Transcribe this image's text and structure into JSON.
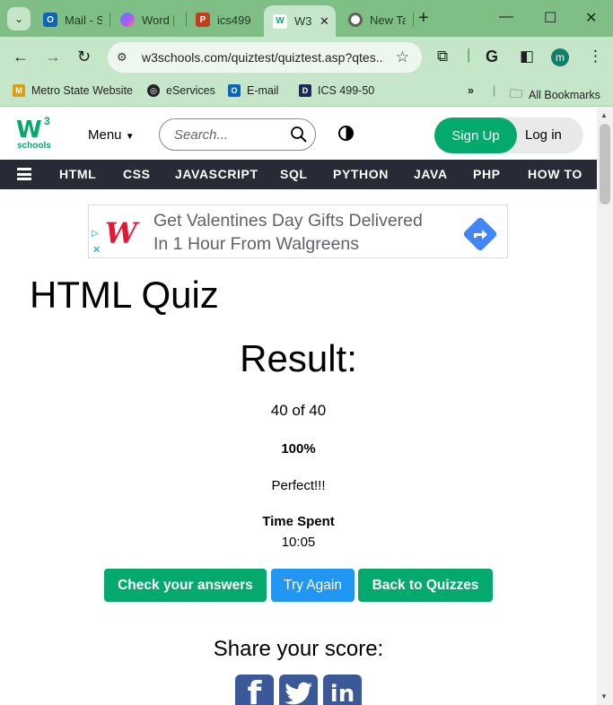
{
  "browser": {
    "tabs": [
      {
        "label": "Mail - S",
        "icon": "outlook-icon",
        "color": "#0a64b8"
      },
      {
        "label": "Word |",
        "icon": "copilot-icon",
        "color": "#7b5cd6"
      },
      {
        "label": "ics499.",
        "icon": "powerpoint-icon",
        "color": "#c43e1c"
      },
      {
        "label": "W3",
        "icon": "w3schools-icon",
        "color": "#04aa6d",
        "active": true
      },
      {
        "label": "New Ta",
        "icon": "chrome-icon",
        "color": "#606060"
      }
    ],
    "url": "w3schools.com/quiztest/quiztest.asp?qtes...",
    "profile_initial": "m",
    "bookmarks": [
      {
        "label": "Metro State Website",
        "icon": "metro-icon"
      },
      {
        "label": "eServices",
        "icon": "globe-icon"
      },
      {
        "label": "E-mail",
        "icon": "outlook-icon"
      },
      {
        "label": "ICS 499-50",
        "icon": "d2l-icon"
      }
    ],
    "all_bookmarks_label": "All Bookmarks"
  },
  "header": {
    "logo_three": "3",
    "logo_schools": "schools",
    "menu_label": "Menu",
    "search_placeholder": "Search...",
    "signup_label": "Sign Up",
    "login_label": "Log in"
  },
  "topnav": [
    "HTML",
    "CSS",
    "JAVASCRIPT",
    "SQL",
    "PYTHON",
    "JAVA",
    "PHP",
    "HOW TO"
  ],
  "ad": {
    "line1": "Get Valentines Day Gifts Delivered",
    "line2": "In 1 Hour From Walgreens"
  },
  "quiz": {
    "title": "HTML Quiz",
    "result_heading": "Result:",
    "score": "40 of 40",
    "percent": "100%",
    "message": "Perfect!!!",
    "time_spent_label": "Time Spent",
    "time_spent_value": "10:05"
  },
  "buttons": {
    "check": "Check your answers",
    "try_again": "Try Again",
    "back": "Back to Quizzes"
  },
  "share": {
    "heading": "Share your score:",
    "facebook": "f",
    "linkedin": "in"
  },
  "colors": {
    "brand_green": "#04aa6d",
    "nav_dark": "#282a35",
    "try_again_blue": "#2196f3"
  }
}
